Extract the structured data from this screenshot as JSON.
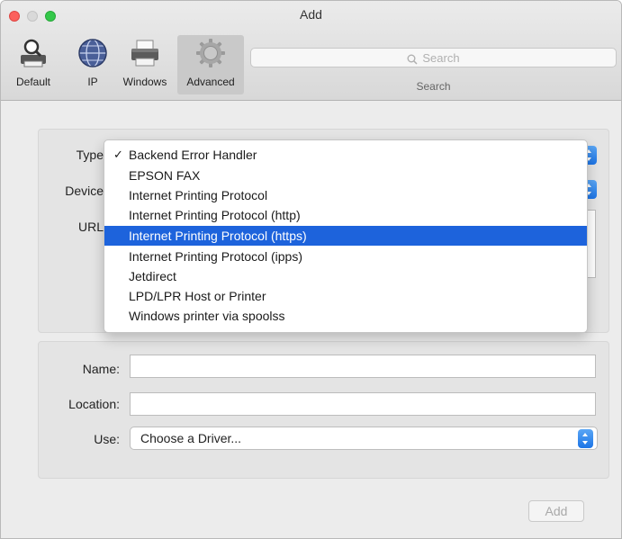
{
  "window": {
    "title": "Add"
  },
  "toolbar": {
    "items": [
      {
        "label": "Default",
        "icon": "magnifier-printer-icon",
        "selected": false
      },
      {
        "label": "IP",
        "icon": "globe-icon",
        "selected": false
      },
      {
        "label": "Windows",
        "icon": "printer-icon",
        "selected": false
      },
      {
        "label": "Advanced",
        "icon": "gear-icon",
        "selected": true
      }
    ],
    "search": {
      "placeholder": "Search",
      "label": "Search"
    }
  },
  "form": {
    "type_label": "Type",
    "device_label": "Device",
    "url_label": "URL",
    "name_label": "Name:",
    "name_value": "",
    "location_label": "Location:",
    "location_value": "",
    "use_label": "Use:",
    "use_value": "Choose a Driver..."
  },
  "type_menu": {
    "checked": "Backend Error Handler",
    "highlighted": "Internet Printing Protocol (https)",
    "options": [
      "Backend Error Handler",
      "EPSON FAX",
      "Internet Printing Protocol",
      "Internet Printing Protocol (http)",
      "Internet Printing Protocol (https)",
      "Internet Printing Protocol (ipps)",
      "Jetdirect",
      "LPD/LPR Host or Printer",
      "Windows printer via spoolss"
    ]
  },
  "buttons": {
    "add_label": "Add"
  },
  "colors": {
    "accent": "#1d63dc",
    "close": "#fc605c",
    "zoom": "#34c84a",
    "minimize_disabled": "#d9d9d9"
  }
}
